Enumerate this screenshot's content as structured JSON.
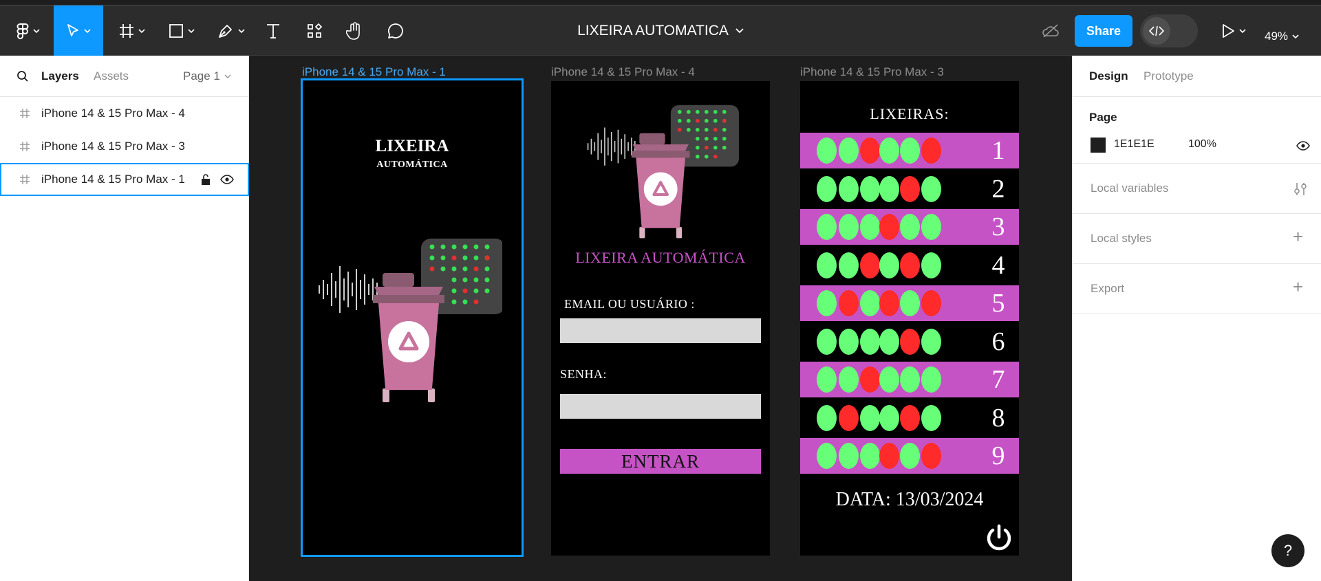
{
  "document": {
    "title": "LIXEIRA AUTOMATICA",
    "zoom": "49%"
  },
  "toolbar": {
    "share_label": "Share"
  },
  "left_panel": {
    "tabs": {
      "layers": "Layers",
      "assets": "Assets",
      "page": "Page 1"
    },
    "layers": [
      {
        "name": "iPhone 14 & 15 Pro Max - 4",
        "selected": false
      },
      {
        "name": "iPhone 14 & 15 Pro Max - 3",
        "selected": false
      },
      {
        "name": "iPhone 14 & 15 Pro Max - 1",
        "selected": true
      }
    ]
  },
  "canvas": {
    "frames": [
      {
        "label": "iPhone 14 & 15 Pro Max - 1",
        "title": "LIXEIRA",
        "subtitle": "AUTOMÁTICA"
      },
      {
        "label": "iPhone 14 & 15 Pro Max - 4",
        "brand": "LIXEIRA AUTOMÁTICA",
        "email_label": "EMAIL OU USUÁRIO :",
        "password_label": "SENHA:",
        "enter_label": "ENTRAR"
      },
      {
        "label": "iPhone 14 & 15 Pro Max - 3",
        "title": "LIXEIRAS:",
        "rows": [
          {
            "number": "1",
            "highlight": true,
            "status": [
              "g",
              "g",
              "r",
              "g",
              "g",
              "r"
            ]
          },
          {
            "number": "2",
            "highlight": false,
            "status": [
              "g",
              "g",
              "g",
              "g",
              "r",
              "g"
            ]
          },
          {
            "number": "3",
            "highlight": true,
            "status": [
              "g",
              "g",
              "g",
              "r",
              "g",
              "g"
            ]
          },
          {
            "number": "4",
            "highlight": false,
            "status": [
              "g",
              "g",
              "r",
              "g",
              "r",
              "g"
            ]
          },
          {
            "number": "5",
            "highlight": true,
            "status": [
              "g",
              "r",
              "g",
              "r",
              "g",
              "r"
            ]
          },
          {
            "number": "6",
            "highlight": false,
            "status": [
              "g",
              "g",
              "g",
              "g",
              "r",
              "g"
            ]
          },
          {
            "number": "7",
            "highlight": true,
            "status": [
              "g",
              "g",
              "r",
              "g",
              "g",
              "g"
            ]
          },
          {
            "number": "8",
            "highlight": false,
            "status": [
              "g",
              "r",
              "g",
              "g",
              "r",
              "g"
            ]
          },
          {
            "number": "9",
            "highlight": true,
            "status": [
              "g",
              "g",
              "g",
              "r",
              "g",
              "r"
            ]
          }
        ],
        "date": "DATA: 13/03/2024"
      }
    ]
  },
  "right_panel": {
    "tabs": {
      "design": "Design",
      "prototype": "Prototype"
    },
    "page_section": {
      "title": "Page",
      "color_hex": "1E1E1E",
      "opacity": "100%"
    },
    "sections": {
      "local_variables": "Local variables",
      "local_styles": "Local styles",
      "export": "Export"
    }
  },
  "colors": {
    "accent": "#0d99ff",
    "magenta": "#c653c6",
    "status_green": "#66ff77",
    "status_red": "#ff2a2a",
    "bin_pink": "#c8739e",
    "canvas_bg": "#1e1e1e",
    "page_swatch": "#1e1e1e"
  },
  "icons": {
    "figma_menu": "figma-logo-icon",
    "move": "cursor-arrow-icon",
    "frame": "frame-hash-icon",
    "shape": "rectangle-icon",
    "pen": "pen-icon",
    "text": "text-t-icon",
    "resources": "components-icon",
    "hand": "hand-icon",
    "comment": "speech-bubble-icon",
    "visibility": "eye-icon",
    "lock": "unlock-icon",
    "present": "play-icon",
    "power": "power-icon"
  },
  "help_label": "?"
}
